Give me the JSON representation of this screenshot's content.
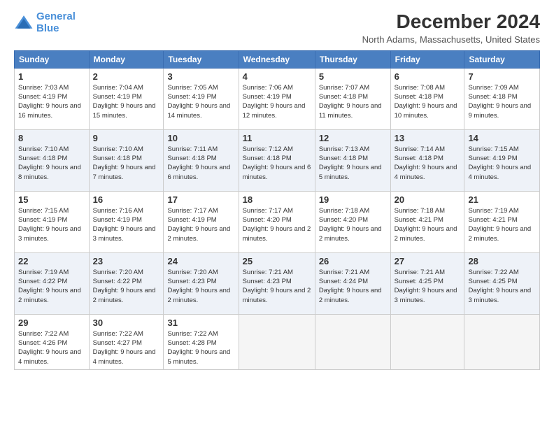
{
  "logo": {
    "line1": "General",
    "line2": "Blue"
  },
  "title": "December 2024",
  "subtitle": "North Adams, Massachusetts, United States",
  "header_days": [
    "Sunday",
    "Monday",
    "Tuesday",
    "Wednesday",
    "Thursday",
    "Friday",
    "Saturday"
  ],
  "weeks": [
    [
      {
        "day": "1",
        "sunrise": "7:03 AM",
        "sunset": "4:19 PM",
        "daylight": "9 hours and 16 minutes."
      },
      {
        "day": "2",
        "sunrise": "7:04 AM",
        "sunset": "4:19 PM",
        "daylight": "9 hours and 15 minutes."
      },
      {
        "day": "3",
        "sunrise": "7:05 AM",
        "sunset": "4:19 PM",
        "daylight": "9 hours and 14 minutes."
      },
      {
        "day": "4",
        "sunrise": "7:06 AM",
        "sunset": "4:19 PM",
        "daylight": "9 hours and 12 minutes."
      },
      {
        "day": "5",
        "sunrise": "7:07 AM",
        "sunset": "4:18 PM",
        "daylight": "9 hours and 11 minutes."
      },
      {
        "day": "6",
        "sunrise": "7:08 AM",
        "sunset": "4:18 PM",
        "daylight": "9 hours and 10 minutes."
      },
      {
        "day": "7",
        "sunrise": "7:09 AM",
        "sunset": "4:18 PM",
        "daylight": "9 hours and 9 minutes."
      }
    ],
    [
      {
        "day": "8",
        "sunrise": "7:10 AM",
        "sunset": "4:18 PM",
        "daylight": "9 hours and 8 minutes."
      },
      {
        "day": "9",
        "sunrise": "7:10 AM",
        "sunset": "4:18 PM",
        "daylight": "9 hours and 7 minutes."
      },
      {
        "day": "10",
        "sunrise": "7:11 AM",
        "sunset": "4:18 PM",
        "daylight": "9 hours and 6 minutes."
      },
      {
        "day": "11",
        "sunrise": "7:12 AM",
        "sunset": "4:18 PM",
        "daylight": "9 hours and 6 minutes."
      },
      {
        "day": "12",
        "sunrise": "7:13 AM",
        "sunset": "4:18 PM",
        "daylight": "9 hours and 5 minutes."
      },
      {
        "day": "13",
        "sunrise": "7:14 AM",
        "sunset": "4:18 PM",
        "daylight": "9 hours and 4 minutes."
      },
      {
        "day": "14",
        "sunrise": "7:15 AM",
        "sunset": "4:19 PM",
        "daylight": "9 hours and 4 minutes."
      }
    ],
    [
      {
        "day": "15",
        "sunrise": "7:15 AM",
        "sunset": "4:19 PM",
        "daylight": "9 hours and 3 minutes."
      },
      {
        "day": "16",
        "sunrise": "7:16 AM",
        "sunset": "4:19 PM",
        "daylight": "9 hours and 3 minutes."
      },
      {
        "day": "17",
        "sunrise": "7:17 AM",
        "sunset": "4:19 PM",
        "daylight": "9 hours and 2 minutes."
      },
      {
        "day": "18",
        "sunrise": "7:17 AM",
        "sunset": "4:20 PM",
        "daylight": "9 hours and 2 minutes."
      },
      {
        "day": "19",
        "sunrise": "7:18 AM",
        "sunset": "4:20 PM",
        "daylight": "9 hours and 2 minutes."
      },
      {
        "day": "20",
        "sunrise": "7:18 AM",
        "sunset": "4:21 PM",
        "daylight": "9 hours and 2 minutes."
      },
      {
        "day": "21",
        "sunrise": "7:19 AM",
        "sunset": "4:21 PM",
        "daylight": "9 hours and 2 minutes."
      }
    ],
    [
      {
        "day": "22",
        "sunrise": "7:19 AM",
        "sunset": "4:22 PM",
        "daylight": "9 hours and 2 minutes."
      },
      {
        "day": "23",
        "sunrise": "7:20 AM",
        "sunset": "4:22 PM",
        "daylight": "9 hours and 2 minutes."
      },
      {
        "day": "24",
        "sunrise": "7:20 AM",
        "sunset": "4:23 PM",
        "daylight": "9 hours and 2 minutes."
      },
      {
        "day": "25",
        "sunrise": "7:21 AM",
        "sunset": "4:23 PM",
        "daylight": "9 hours and 2 minutes."
      },
      {
        "day": "26",
        "sunrise": "7:21 AM",
        "sunset": "4:24 PM",
        "daylight": "9 hours and 2 minutes."
      },
      {
        "day": "27",
        "sunrise": "7:21 AM",
        "sunset": "4:25 PM",
        "daylight": "9 hours and 3 minutes."
      },
      {
        "day": "28",
        "sunrise": "7:22 AM",
        "sunset": "4:25 PM",
        "daylight": "9 hours and 3 minutes."
      }
    ],
    [
      {
        "day": "29",
        "sunrise": "7:22 AM",
        "sunset": "4:26 PM",
        "daylight": "9 hours and 4 minutes."
      },
      {
        "day": "30",
        "sunrise": "7:22 AM",
        "sunset": "4:27 PM",
        "daylight": "9 hours and 4 minutes."
      },
      {
        "day": "31",
        "sunrise": "7:22 AM",
        "sunset": "4:28 PM",
        "daylight": "9 hours and 5 minutes."
      },
      null,
      null,
      null,
      null
    ]
  ]
}
